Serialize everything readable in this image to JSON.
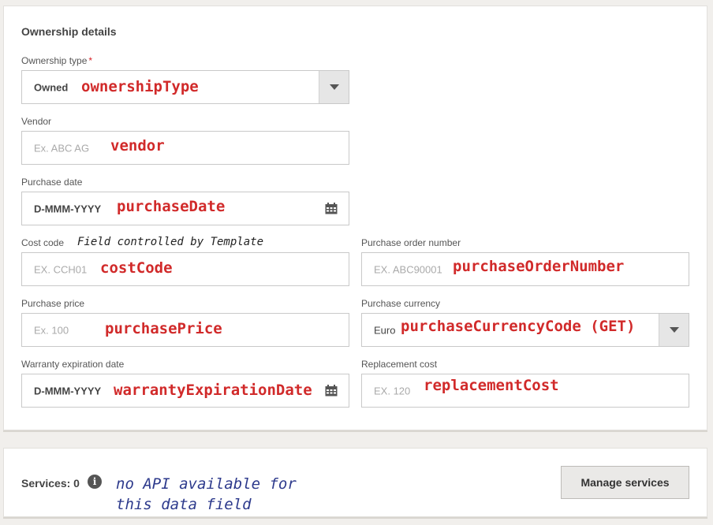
{
  "section": {
    "title": "Ownership details"
  },
  "fields": {
    "ownership_type": {
      "label": "Ownership type",
      "required_mark": "*",
      "value": "Owned",
      "annotation": "ownershipType"
    },
    "vendor": {
      "label": "Vendor",
      "placeholder": "Ex. ABC AG",
      "annotation": "vendor"
    },
    "purchase_date": {
      "label": "Purchase date",
      "value": "D-MMM-YYYY",
      "annotation": "purchaseDate"
    },
    "cost_code": {
      "label": "Cost code",
      "note": "Field controlled by Template",
      "placeholder": "EX. CCH01",
      "annotation": "costCode"
    },
    "purchase_order_number": {
      "label": "Purchase order number",
      "placeholder": "EX. ABC90001",
      "annotation": "purchaseOrderNumber"
    },
    "purchase_price": {
      "label": "Purchase price",
      "placeholder": "Ex. 100",
      "annotation": "purchasePrice"
    },
    "purchase_currency": {
      "label": "Purchase currency",
      "value": "Euro",
      "annotation": "purchaseCurrencyCode (GET)"
    },
    "warranty_expiration_date": {
      "label": "Warranty expiration date",
      "value": "D-MMM-YYYY",
      "annotation": "warrantyExpirationDate"
    },
    "replacement_cost": {
      "label": "Replacement cost",
      "placeholder": "EX. 120",
      "annotation": "replacementCost"
    }
  },
  "services": {
    "label": "Services: 0",
    "info_glyph": "i",
    "annotation_line1": "no API available for",
    "annotation_line2": "this data field",
    "manage_label": "Manage services"
  },
  "icons": {
    "dropdown": "chevron-down-icon",
    "calendar": "calendar-icon",
    "info": "info-icon"
  },
  "colors": {
    "required": "#d81f26",
    "annotation_red": "#d12a2a",
    "annotation_blue": "#2d3a8c"
  }
}
